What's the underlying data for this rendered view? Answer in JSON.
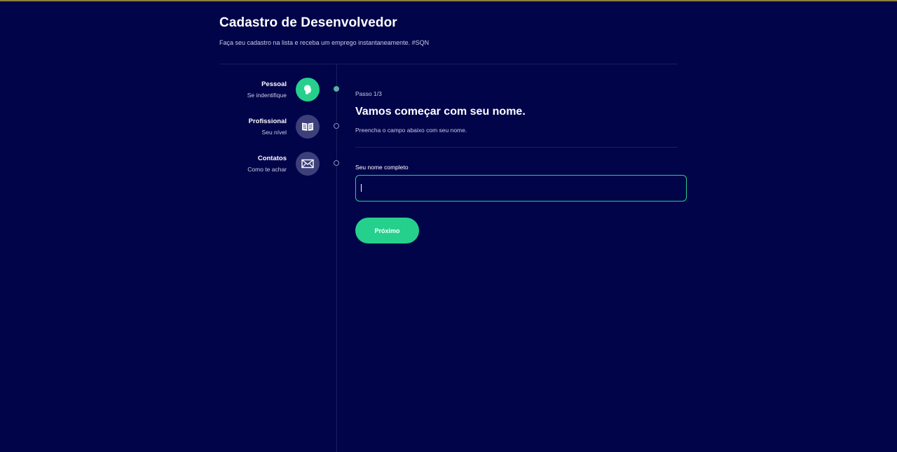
{
  "header": {
    "title": "Cadastro de Desenvolvedor",
    "subtitle": "Faça seu cadastro na lista e receba um emprego instantaneamente. #SQN"
  },
  "steps": [
    {
      "title": "Pessoal",
      "subtitle": "Se indentifique",
      "icon": "person-icon",
      "active": true
    },
    {
      "title": "Profissional",
      "subtitle": "Seu nível",
      "icon": "book-icon",
      "active": false
    },
    {
      "title": "Contatos",
      "subtitle": "Como te achar",
      "icon": "mail-icon",
      "active": false
    }
  ],
  "main": {
    "step_count": "Passo 1/3",
    "heading": "Vamos começar com seu nome.",
    "description": "Preencha o campo abaixo com seu nome.",
    "name_label": "Seu nome completo",
    "name_value": "",
    "next_label": "Próximo"
  },
  "colors": {
    "background": "#02044a",
    "accent": "#25d08c",
    "inactive_circle": "#3c3f7a"
  }
}
